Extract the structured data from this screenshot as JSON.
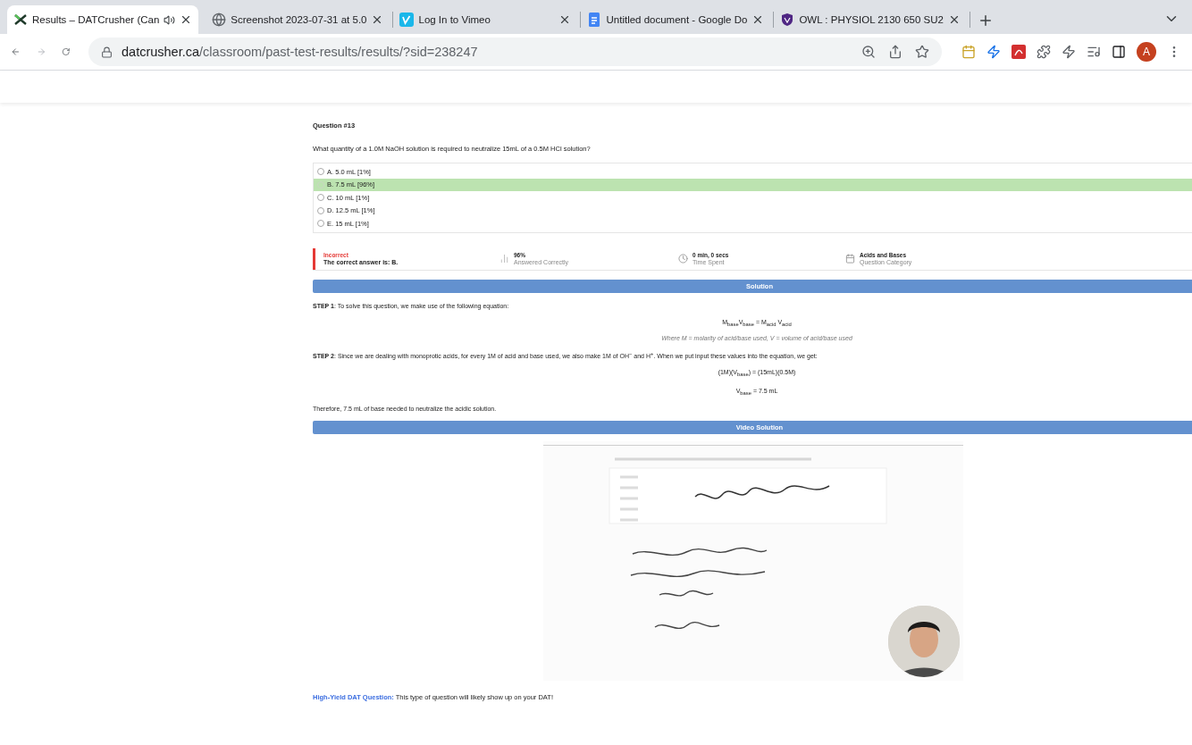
{
  "browser": {
    "tabs": [
      {
        "title": "Results – DATCrusher (Can",
        "selected": true,
        "audio": true
      },
      {
        "title": "Screenshot 2023-07-31 at 5.0",
        "selected": false,
        "audio": false
      },
      {
        "title": "Log In to Vimeo",
        "selected": false,
        "audio": false
      },
      {
        "title": "Untitled document - Google Do",
        "selected": false,
        "audio": false
      },
      {
        "title": "OWL : PHYSIOL 2130 650 SU2",
        "selected": false,
        "audio": false
      }
    ],
    "url": {
      "domain": "datcrusher.ca",
      "path": "/classroom/past-test-results/results/?sid=238247"
    },
    "profile_initial": "A"
  },
  "question": {
    "number": "Question #13",
    "text": "What quantity of a 1.0M NaOH solution is required to neutralize 15mL of a 0.5M HCl solution?",
    "options": [
      {
        "label": "A. 5.0 mL [1%]",
        "correct": false
      },
      {
        "label": "B. 7.5 mL [96%]",
        "correct": true
      },
      {
        "label": "C. 10 mL [1%]",
        "correct": false
      },
      {
        "label": "D. 12.5 mL [1%]",
        "correct": false
      },
      {
        "label": "E. 15 mL [1%]",
        "correct": false
      }
    ]
  },
  "result": {
    "is_correct": false,
    "status": "Incorrect",
    "detail": "The correct answer is: B.",
    "stats": [
      {
        "kind": "chart",
        "value": "96%",
        "label": "Answered Correctly"
      },
      {
        "kind": "clock",
        "value": "0 min, 0 secs",
        "label": "Time Spent"
      },
      {
        "kind": "calendar",
        "value": "Acids and Bases",
        "label": "Question Category"
      }
    ]
  },
  "solution": {
    "header": "Solution",
    "lines": [
      {
        "kind": "text",
        "text": "**STEP 1**: To solve this question, we make use of the following equation:"
      },
      {
        "kind": "equation",
        "text": "M$_{base}$V$_{base}$ = M$_{acid}$ V$_{acid}$"
      },
      {
        "kind": "note",
        "text": "Where M = molarity of acid/base used, V = volume of acid/base used"
      },
      {
        "kind": "text",
        "text": "**STEP 2**: Since we are dealing with monoprotic acids, for every 1M of acid and base used, we also make 1M of OH$^{−}$ and H$^{+}$. When we put input these values into the equation, we get:"
      },
      {
        "kind": "equation",
        "text": "(1M)(V$_{base}$) = (15mL)(0.5M)"
      },
      {
        "kind": "equation",
        "text": "V$_{base}$ = 7.5 mL"
      },
      {
        "kind": "text",
        "text": "Therefore, 7.5 mL of base needed to neutralize the acidic solution."
      }
    ]
  },
  "video": {
    "header": "Video Solution",
    "kind": "picture"
  },
  "footer": {
    "highlight": "High-Yield DAT Question:",
    "text": "This type of question will likely show up on your DAT!"
  }
}
